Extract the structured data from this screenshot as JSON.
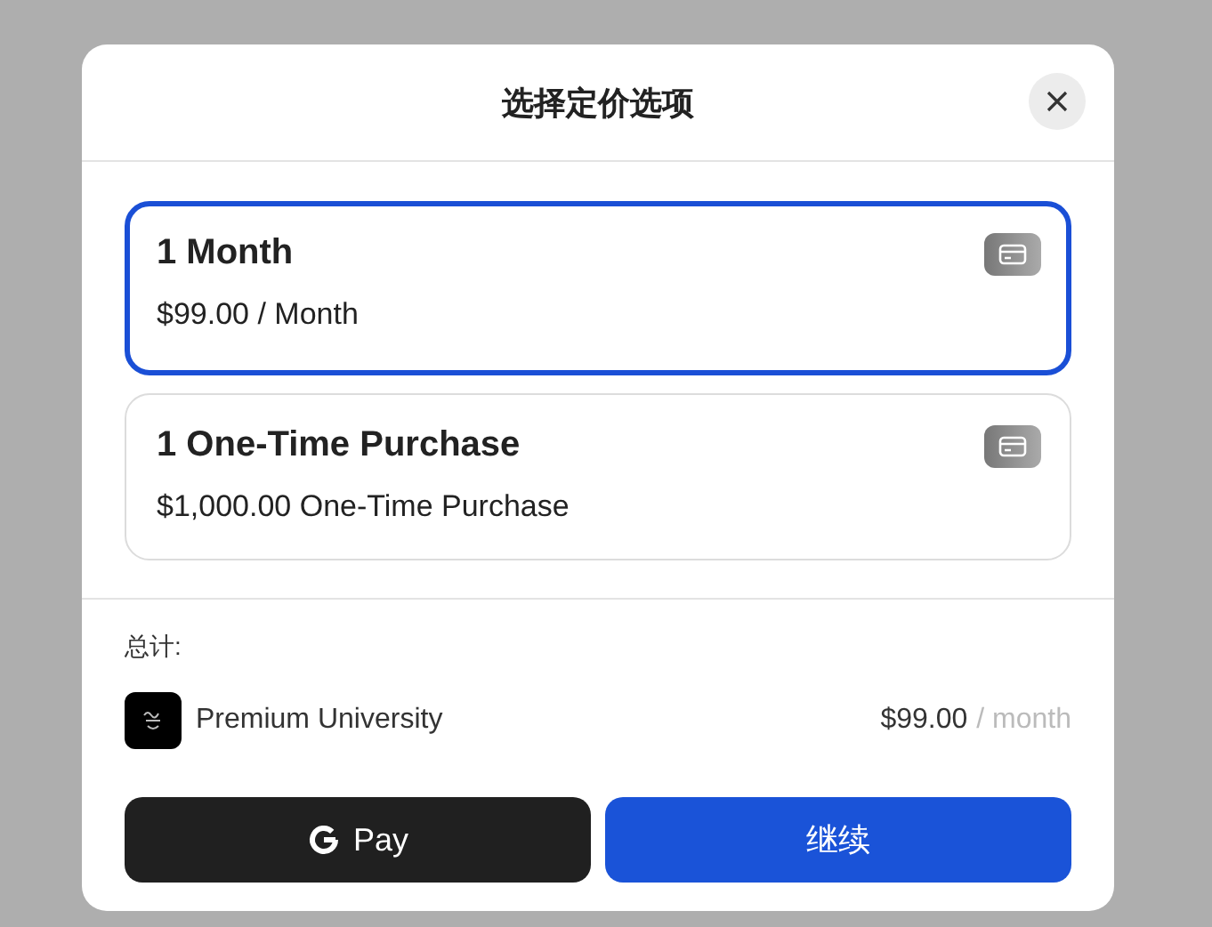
{
  "dialog": {
    "title": "选择定价选项"
  },
  "options": [
    {
      "name": "1 Month",
      "price": "$99.00 / Month",
      "selected": true
    },
    {
      "name": "1 One-Time Purchase",
      "price": "$1,000.00 One-Time Purchase",
      "selected": false
    }
  ],
  "total": {
    "label": "总计:",
    "product": "Premium University",
    "amount": "$99.00",
    "period": "/ month"
  },
  "buttons": {
    "gpay": "Pay",
    "continue": "继续"
  }
}
